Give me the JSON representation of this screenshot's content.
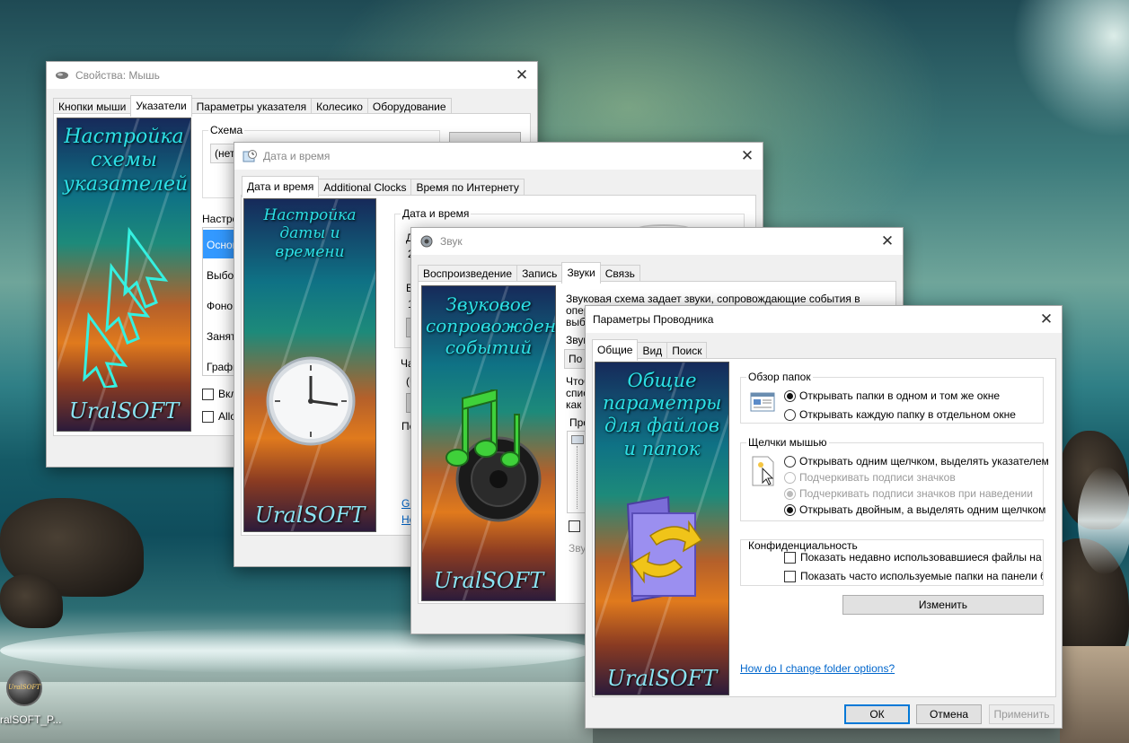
{
  "desktop": {
    "icon_label": "ralSOFT_P...",
    "icon_badge": "UralSOFT"
  },
  "mouse_window": {
    "title": "Свойства: Мышь",
    "tabs": [
      "Кнопки мыши",
      "Указатели",
      "Параметры указателя",
      "Колесико",
      "Оборудование"
    ],
    "selected_tab": "Указатели",
    "banner_title": "Настройка схемы указателей",
    "banner_footer": "UralSOFT",
    "scheme_label": "Схема",
    "scheme_value": "(нет)",
    "customize_label": "Настрой",
    "list_items": [
      "Основ",
      "Выбор",
      "Фонов",
      "Занят",
      "Графи"
    ],
    "check1": "Вклю",
    "check2": "Allow"
  },
  "datetime_window": {
    "title": "Дата и время",
    "tabs": [
      "Дата и время",
      "Additional Clocks",
      "Время по Интернету"
    ],
    "selected_tab": "Дата и время",
    "banner_title": "Настройка даты и времени",
    "banner_footer": "UralSOFT",
    "group_label": "Дата и время",
    "frag_d": "Д",
    "frag_2": "2",
    "frag_v": "В",
    "frag_1": "1",
    "frag_ch": "Ча",
    "frag_u": "(U",
    "frag_pe": "Пе",
    "link1": "Ge",
    "link2": "Но"
  },
  "sound_window": {
    "title": "Звук",
    "tabs": [
      "Воспроизведение",
      "Запись",
      "Звуки",
      "Связь"
    ],
    "selected_tab": "Звуки",
    "banner_title": "Звуковое сопровождение событий",
    "banner_footer": "UralSOFT",
    "desc_line1": "Звуковая схема задает звуки, сопровождающие события в",
    "desc_line2": "опер",
    "desc_line3": "выб",
    "scheme_label": "Звук",
    "scheme_value": "По",
    "frag_chto": "Чтоб",
    "frag_spis": "спис",
    "frag_kak": "как",
    "frag_pro": "Про",
    "frag_zvu": "Звук"
  },
  "explorer_window": {
    "title": "Параметры Проводника",
    "tabs": [
      "Общие",
      "Вид",
      "Поиск"
    ],
    "selected_tab": "Общие",
    "banner_title": "Общие параметры для файлов и папок",
    "banner_footer": "UralSOFT",
    "browse_group": {
      "label": "Обзор папок",
      "options": [
        "Открывать папки в одном и том же окне",
        "Открывать каждую папку в отдельном окне"
      ],
      "selected": 0
    },
    "click_group": {
      "label": "Щелчки мышью",
      "options": [
        "Открывать одним щелчком, выделять указателем",
        "Подчеркивать подписи значков",
        "Подчеркивать подписи значков при наведении",
        "Открывать двойным, а выделять одним щелчком"
      ],
      "selected": 3
    },
    "privacy_group": {
      "label": "Конфиденциальность",
      "options": [
        "Показать недавно использовавшиеся файлы на пане",
        "Показать часто используемые папки на панели быст"
      ]
    },
    "change_button": "Изменить",
    "help_link": "How do I change folder options?",
    "ok_button": "ОК",
    "cancel_button": "Отмена",
    "apply_button": "Применить"
  }
}
